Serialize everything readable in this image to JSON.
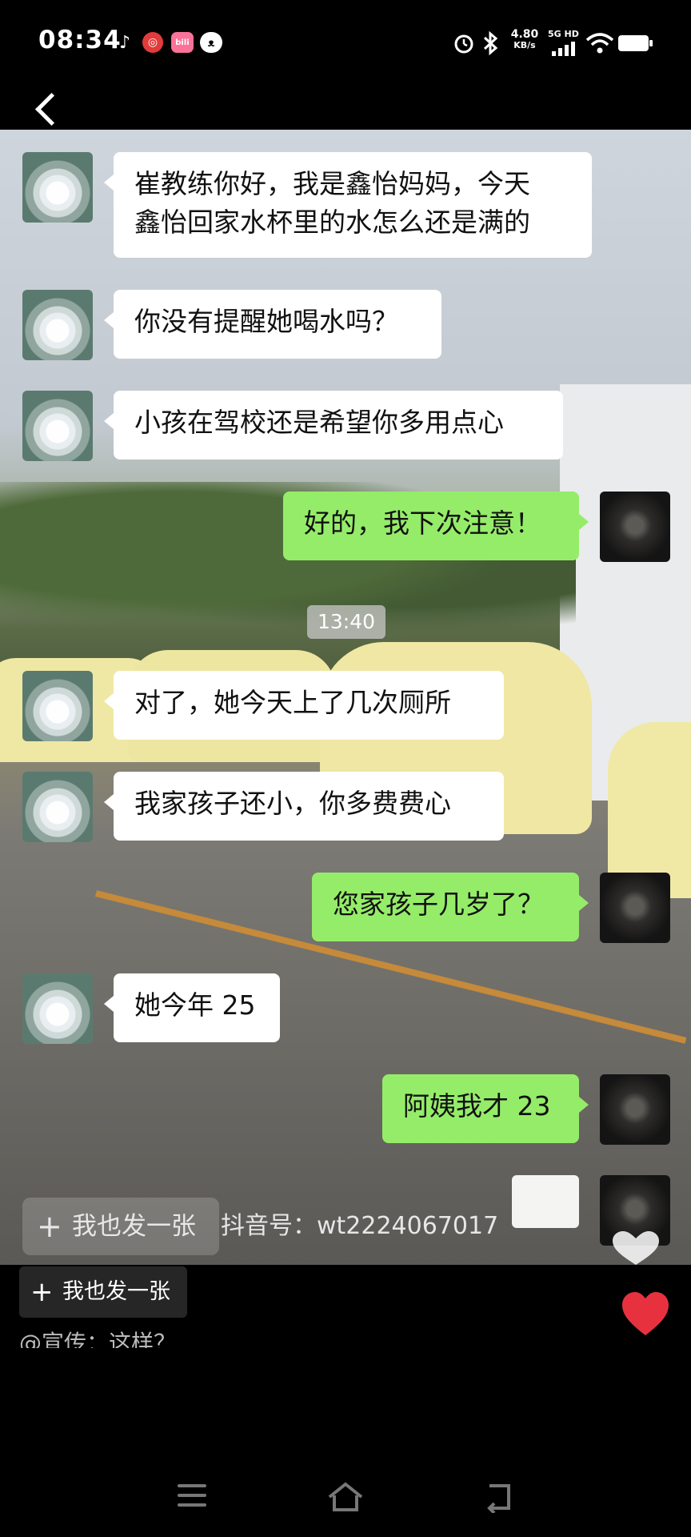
{
  "status_bar": {
    "time": "08:34",
    "notification_icons": [
      "tiktok-icon",
      "netease-music-icon",
      "bilibili-icon",
      "cat-app-icon"
    ],
    "net_speed_value": "4.80",
    "net_speed_unit": "KB/s",
    "network_type": "5G HD",
    "system_icons": [
      "alarm-icon",
      "bluetooth-icon",
      "signal-icon",
      "wifi-icon",
      "battery-icon"
    ]
  },
  "chat": {
    "messages": [
      {
        "side": "left",
        "text": "崔教练你好，我是鑫怡妈妈，今天\n鑫怡回家水杯里的水怎么还是满的"
      },
      {
        "side": "left",
        "text": "你没有提醒她喝水吗？"
      },
      {
        "side": "left",
        "text": "小孩在驾校还是希望你多用点心"
      },
      {
        "side": "right",
        "text": "好的，我下次注意！"
      },
      {
        "side": "left",
        "text": "对了，她今天上了几次厕所"
      },
      {
        "side": "left",
        "text": "我家孩子还小，你多费费心"
      },
      {
        "side": "right",
        "text": "您家孩子几岁了？"
      },
      {
        "side": "left",
        "text": "她今年 25"
      },
      {
        "side": "right",
        "text": "阿姨我才 23"
      }
    ],
    "timestamp": "13:40"
  },
  "overlay": {
    "post_button_label": "我也发一张",
    "douyin_id": "抖音号：wt2224067017"
  },
  "bottom": {
    "repost_label": "我也发一张",
    "author_caption": "@宣传：这样？"
  },
  "colors": {
    "sent_bubble": "#95ec69",
    "received_bubble": "#ffffff",
    "like_heart": "#e8313f"
  }
}
